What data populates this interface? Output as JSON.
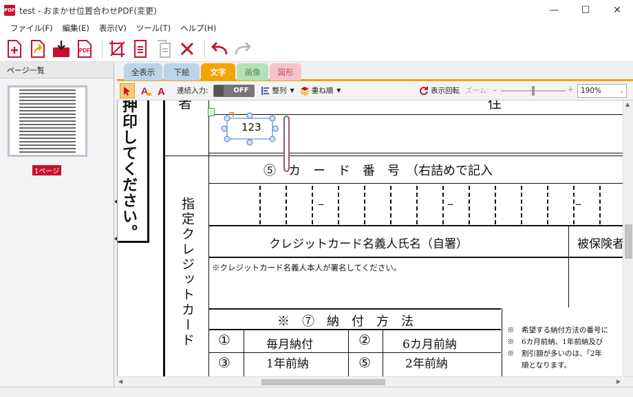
{
  "window": {
    "title": "test - おまかせ位置合わせPDF(変更)",
    "app_icon": "PDF",
    "minimize": "—",
    "maximize": "☐",
    "close": "✕"
  },
  "menu": [
    "ファイル(F)",
    "編集(E)",
    "表示(V)",
    "ツール(T)",
    "ヘルプ(H)"
  ],
  "sidebar": {
    "title": "ページ一覧",
    "page_label": "1ページ"
  },
  "tabs": [
    {
      "label": "全表示",
      "color": "#bcd4e8"
    },
    {
      "label": "下絵",
      "color": "#bcd4e8"
    },
    {
      "label": "文字",
      "color": "#f3a400",
      "active": true
    },
    {
      "label": "画像",
      "color": "#b8e0b8"
    },
    {
      "label": "図形",
      "color": "#f6c4c8"
    }
  ],
  "subtoolbar": {
    "continuous_label": "連続入力:",
    "toggle_state": "OFF",
    "align_label": "整列",
    "order_label": "重ね順",
    "rotate_label": "表示回転",
    "zoom_label": "ズーム:",
    "zoom_value": "190%",
    "zoom_fraction": 0.5
  },
  "document": {
    "side_text": "押印してください。",
    "top_fragment": "者",
    "top_right_fragment": "住",
    "text_box_value": "123",
    "card_header": "⑤　カ　ー　ド　番　号　（右詰めで記入",
    "dash": "–",
    "section_label": "指定クレジットカード",
    "name_header": "クレジットカード名義人氏名（自署）",
    "insured_fragment": "被保険者",
    "name_note": "※クレジットカード名義人本人が署名してください。",
    "payment_header": "※　⑦　納　付　方　法",
    "payment_options": [
      {
        "num": "①",
        "label": "毎月納付"
      },
      {
        "num": "②",
        "label": "6カ月前納"
      },
      {
        "num": "③",
        "label": "1年前納"
      },
      {
        "num": "⑤",
        "label": "2年前納"
      }
    ],
    "notes": [
      "※　希望する納付方法の番号に",
      "※　6カ月前納、1年前納及び",
      "※　割引額が多いのは、「2年",
      "　　順となります。"
    ]
  },
  "colors": {
    "accent": "#f3a400",
    "brand_red": "#c8102e",
    "selection_blue": "#3a78c8"
  }
}
